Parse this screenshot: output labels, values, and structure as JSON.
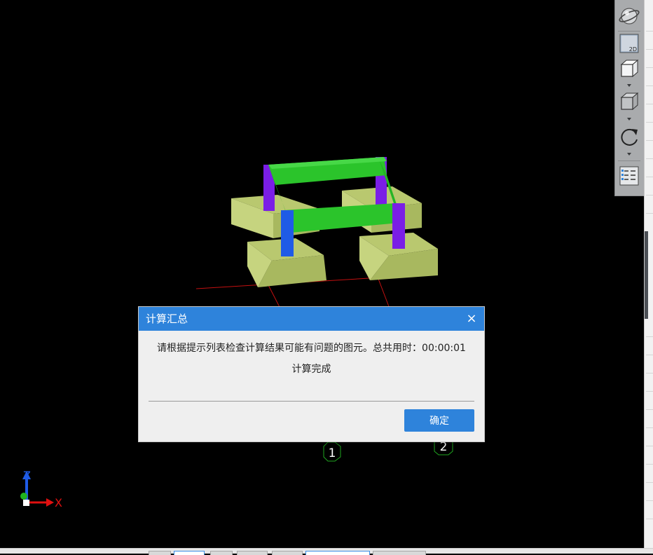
{
  "viewport": {
    "axis_labels": {
      "x": "X",
      "z": "Z"
    },
    "axis_marks": [
      "1",
      "2"
    ],
    "colors": {
      "background": "#000000",
      "footing": "#b5c56e",
      "beam": "#2bc42b",
      "column_blue": "#1f5be6",
      "column_purple": "#7a1ee6",
      "grid_line": "#c41010",
      "axis_bubble": "#1fa51f"
    }
  },
  "toolbar": {
    "items": [
      {
        "icon": "orbit-sphere-icon"
      },
      {
        "icon": "view-2d-icon",
        "label": "2D"
      },
      {
        "icon": "wireframe-cube-icon",
        "dropdown": true
      },
      {
        "icon": "solid-cube-icon",
        "dropdown": true
      },
      {
        "icon": "rotate-icon",
        "dropdown": true
      },
      {
        "icon": "display-settings-icon"
      }
    ]
  },
  "dialog": {
    "title": "计算汇总",
    "close_label": "×",
    "message": "请根据提示列表检查计算结果可能有问题的图元。总共用时：00:00:01",
    "status": "计算完成",
    "ok_label": "确定",
    "accent": "#2e83db"
  },
  "status_bar": {
    "buttons": [
      {
        "name": "btn-1",
        "active": false
      },
      {
        "name": "btn-2",
        "active": true
      },
      {
        "name": "btn-3",
        "active": false
      },
      {
        "name": "btn-4",
        "active": false
      },
      {
        "name": "btn-5",
        "active": false
      },
      {
        "name": "btn-6",
        "active": true
      },
      {
        "name": "btn-7",
        "active": false
      }
    ]
  }
}
